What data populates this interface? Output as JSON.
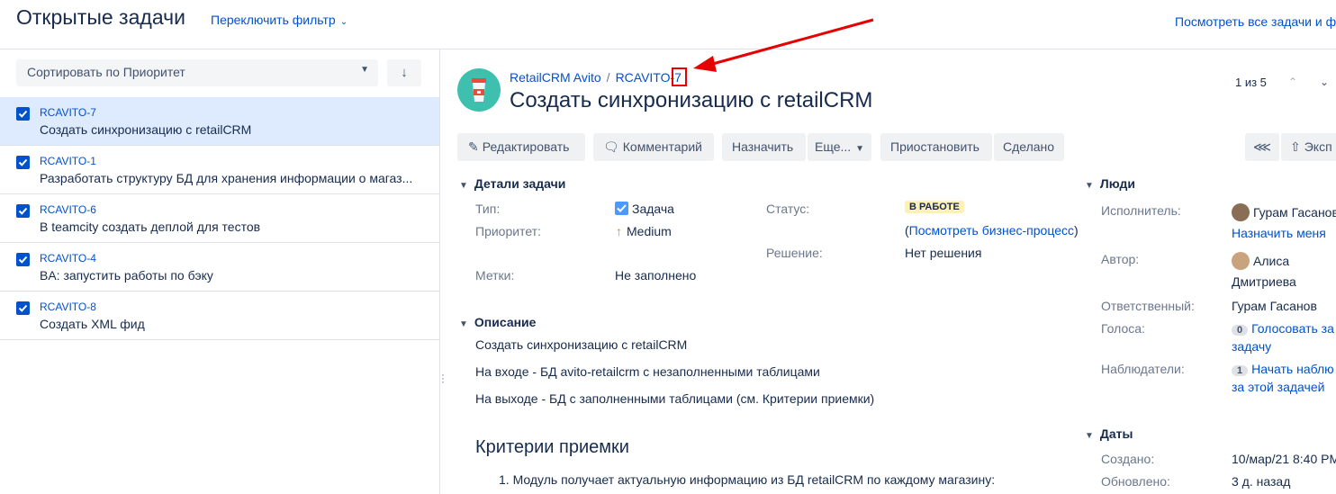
{
  "header": {
    "title": "Открытые задачи",
    "switch_filter": "Переключить фильтр",
    "view_all": "Посмотреть все задачи и ф"
  },
  "sidebar": {
    "sort_label": "Сортировать по Приоритет",
    "sort_dir_icon": "arrow-down-icon",
    "issues": [
      {
        "key": "RCAVITO-7",
        "summary": "Создать синхронизацию с retailCRM",
        "selected": true
      },
      {
        "key": "RCAVITO-1",
        "summary": "Разработать структуру БД для хранения информации о магаз..."
      },
      {
        "key": "RCAVITO-6",
        "summary": "В teamcity создать деплой для тестов"
      },
      {
        "key": "RCAVITO-4",
        "summary": "BA: запустить работы по бэку"
      },
      {
        "key": "RCAVITO-8",
        "summary": "Создать XML фид"
      }
    ]
  },
  "issue": {
    "project": "RetailCRM Avito",
    "key_prefix": "RCAVITO-",
    "key_num": "7",
    "title": "Создать синхронизацию с retailCRM",
    "pager": "1 из 5"
  },
  "toolbar": {
    "edit": "Редактировать",
    "comment": "Комментарий",
    "assign": "Назначить",
    "more": "Еще...",
    "stop": "Приостановить",
    "done": "Сделано",
    "export": "Эксп"
  },
  "details": {
    "heading": "Детали задачи",
    "type_label": "Тип:",
    "type_value": "Задача",
    "priority_label": "Приоритет:",
    "priority_value": "Medium",
    "labels_label": "Метки:",
    "labels_value": "Не заполнено",
    "status_label": "Статус:",
    "status_value": "В РАБОТЕ",
    "workflow_open": "(",
    "workflow_link": "Посмотреть бизнес-процесс",
    "workflow_close": ")",
    "resolution_label": "Решение:",
    "resolution_value": "Нет решения"
  },
  "description": {
    "heading": "Описание",
    "line1": "Создать синхронизацию с retailCRM",
    "line2": "На входе - БД avito-retailcrm с незаполненными таблицами",
    "line3": "На выходе - БД с заполненными таблицами (см. Критерии приемки)",
    "criteria_heading": "Критерии приемки",
    "criteria_item1": "1. Модуль получает актуальную информацию из БД retailCRM по каждому магазину:"
  },
  "people": {
    "heading": "Люди",
    "assignee_label": "Исполнитель:",
    "assignee_value": "Гурам Гасанов",
    "assign_me": "Назначить меня",
    "author_label": "Автор:",
    "author_line1": "Алиса",
    "author_line2": "Дмитриева",
    "responsible_label": "Ответственный:",
    "responsible_value": "Гурам Гасанов",
    "votes_label": "Голоса:",
    "votes_count": "0",
    "votes_line1": "Голосовать за",
    "votes_line2": "задачу",
    "watchers_label": "Наблюдатели:",
    "watchers_count": "1",
    "watchers_line1": "Начать наблю",
    "watchers_line2": "за этой задачей"
  },
  "dates": {
    "heading": "Даты",
    "created_label": "Создано:",
    "created_value": "10/мар/21 8:40 PM",
    "updated_label": "Обновлено:",
    "updated_value": "3 д. назад"
  },
  "colors": {
    "accent": "#0052cc",
    "selected_row": "#deebff",
    "status_bg": "#fff0b3",
    "annotation": "#e60000"
  }
}
